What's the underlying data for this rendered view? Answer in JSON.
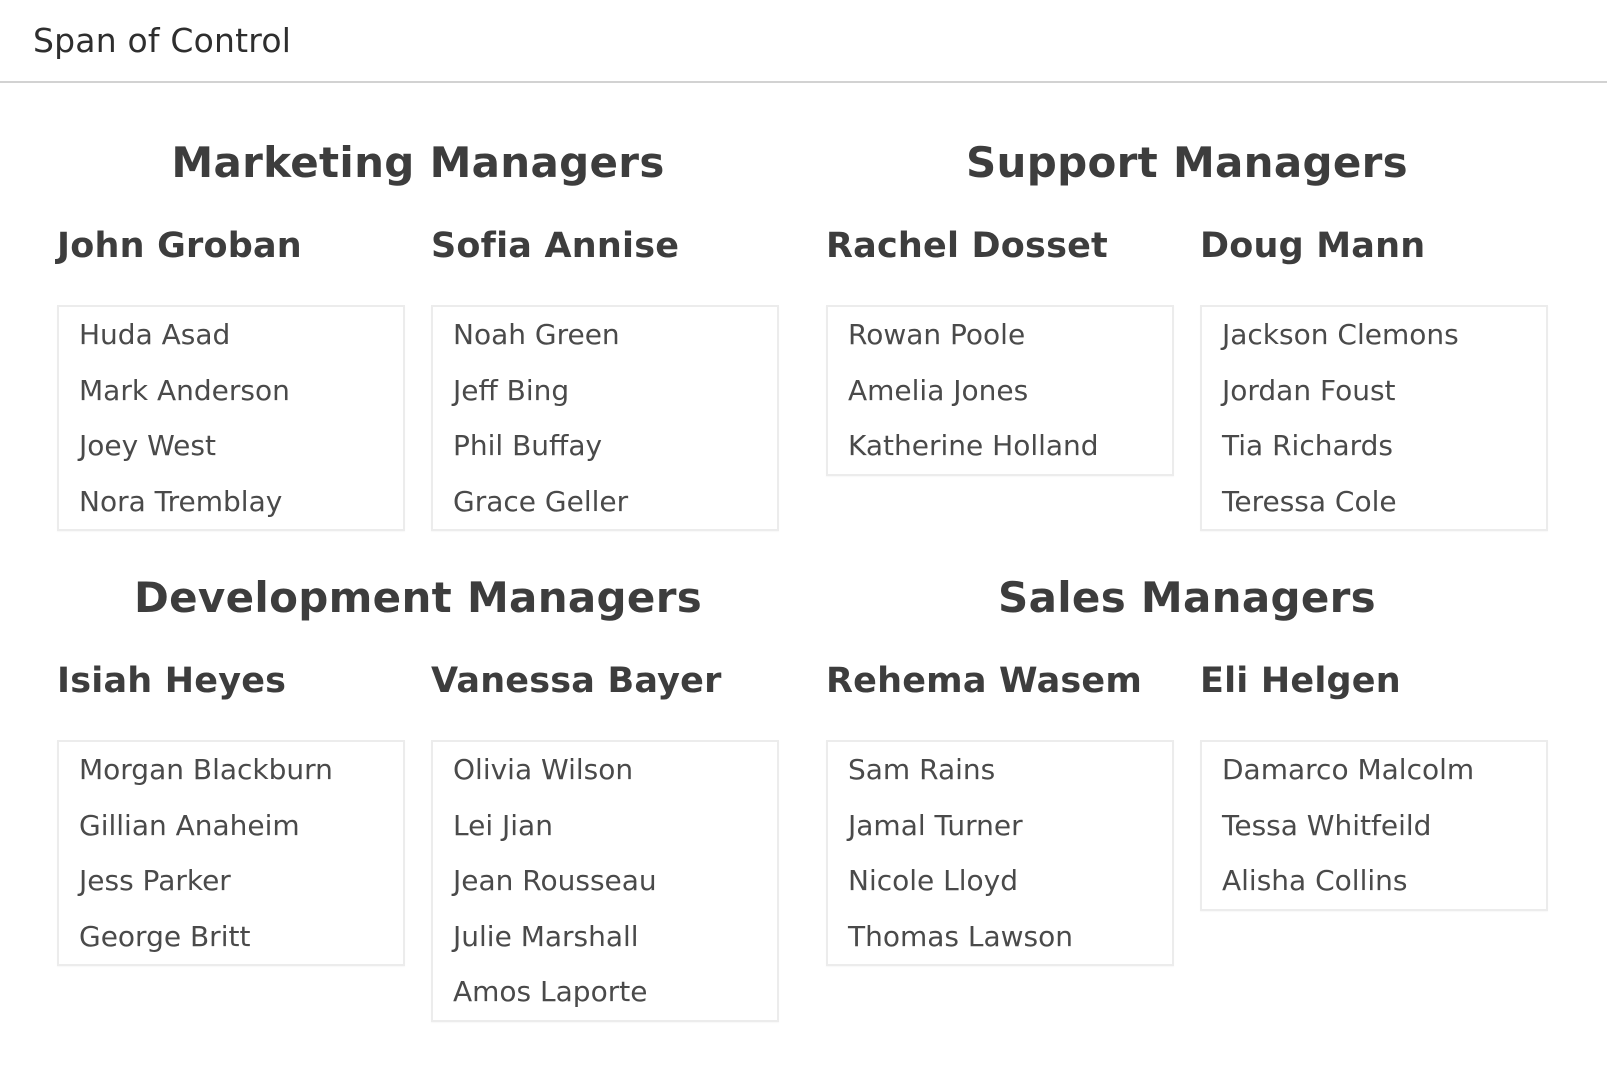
{
  "header": {
    "title": "Span of Control"
  },
  "sections": [
    {
      "title": "Marketing Managers",
      "managers": [
        {
          "name": "John Groban",
          "reports": [
            "Huda Asad",
            "Mark Anderson",
            "Joey West",
            "Nora Tremblay"
          ]
        },
        {
          "name": "Sofia Annise",
          "reports": [
            "Noah Green",
            "Jeff Bing",
            "Phil Buffay",
            "Grace Geller"
          ]
        }
      ]
    },
    {
      "title": "Support Managers",
      "managers": [
        {
          "name": "Rachel Dosset",
          "reports": [
            "Rowan Poole",
            "Amelia Jones",
            "Katherine Holland"
          ]
        },
        {
          "name": "Doug Mann",
          "reports": [
            "Jackson Clemons",
            "Jordan Foust",
            "Tia Richards",
            "Teressa Cole"
          ]
        }
      ]
    },
    {
      "title": "Development Managers",
      "managers": [
        {
          "name": "Isiah Heyes",
          "reports": [
            "Morgan Blackburn",
            "Gillian Anaheim",
            "Jess Parker",
            "George Britt"
          ]
        },
        {
          "name": "Vanessa Bayer",
          "reports": [
            "Olivia Wilson",
            "Lei Jian",
            "Jean Rousseau",
            "Julie Marshall",
            "Amos Laporte"
          ]
        }
      ]
    },
    {
      "title": "Sales Managers",
      "managers": [
        {
          "name": "Rehema Wasem",
          "reports": [
            "Sam Rains",
            "Jamal Turner",
            "Nicole Lloyd",
            "Thomas Lawson"
          ]
        },
        {
          "name": "Eli Helgen",
          "reports": [
            "Damarco Malcolm",
            "Tessa Whitfeild",
            "Alisha Collins"
          ]
        }
      ]
    }
  ]
}
